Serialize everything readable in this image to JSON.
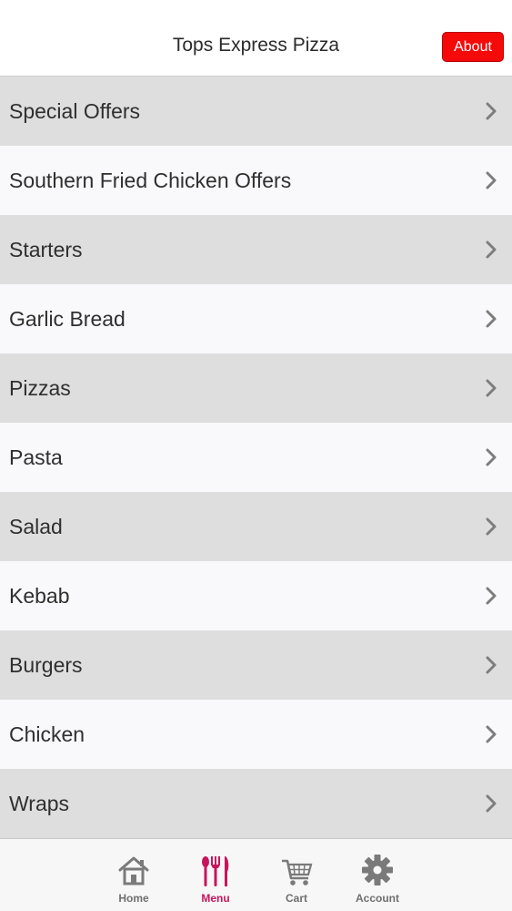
{
  "header": {
    "title": "Tops Express Pizza",
    "about_label": "About"
  },
  "menu": {
    "items": [
      {
        "label": "Special Offers"
      },
      {
        "label": "Southern Fried Chicken Offers"
      },
      {
        "label": "Starters"
      },
      {
        "label": "Garlic Bread"
      },
      {
        "label": "Pizzas"
      },
      {
        "label": "Pasta"
      },
      {
        "label": "Salad"
      },
      {
        "label": "Kebab"
      },
      {
        "label": "Burgers"
      },
      {
        "label": "Chicken"
      },
      {
        "label": "Wraps"
      }
    ]
  },
  "tabbar": {
    "tabs": [
      {
        "label": "Home",
        "icon": "house-icon"
      },
      {
        "label": "Menu",
        "icon": "cutlery-icon"
      },
      {
        "label": "Cart",
        "icon": "cart-icon"
      },
      {
        "label": "Account",
        "icon": "gear-icon"
      }
    ],
    "active_index": 1
  },
  "colors": {
    "about_button": "#f50a0a",
    "active_tab": "#c8145a",
    "shaded_row": "#dededf",
    "plain_row": "#f9f9fb"
  }
}
